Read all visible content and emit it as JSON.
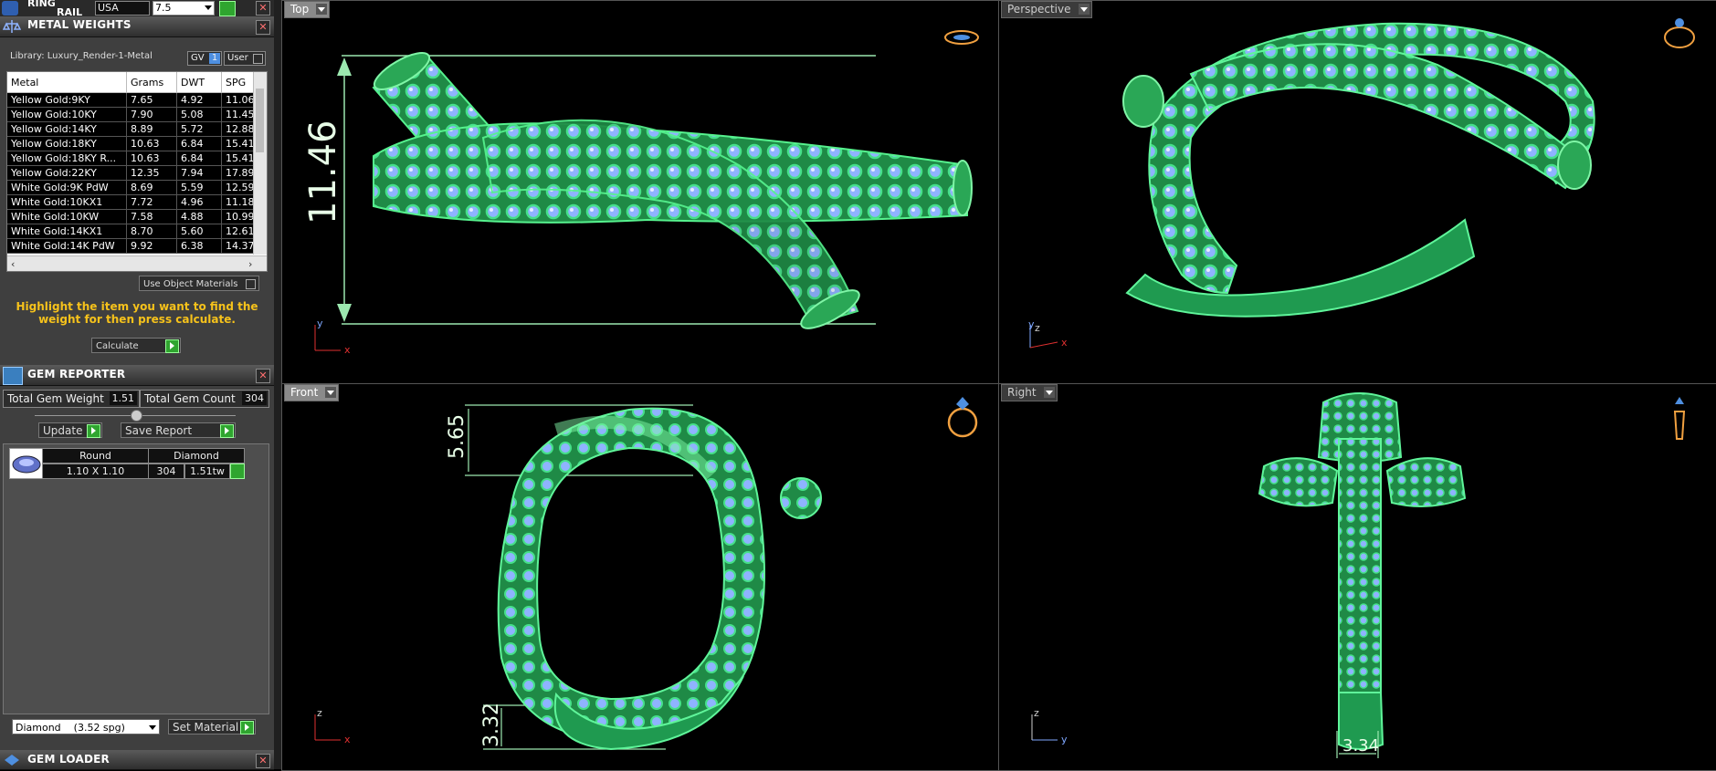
{
  "ringrail": {
    "title_line1": "RING",
    "title_line2": "RAIL",
    "country": "USA",
    "size": "7.5"
  },
  "metal_weights": {
    "title": "METAL WEIGHTS",
    "library": "Library: Luxury_Render-1-Metal",
    "gv": "GV",
    "gv_num": "1",
    "user": "User",
    "columns": [
      "Metal",
      "Grams",
      "DWT",
      "SPG"
    ],
    "rows": [
      [
        "Yellow Gold:9KY",
        "7.65",
        "4.92",
        "11.06"
      ],
      [
        "Yellow Gold:10KY",
        "7.90",
        "5.08",
        "11.45"
      ],
      [
        "Yellow Gold:14KY",
        "8.89",
        "5.72",
        "12.88"
      ],
      [
        "Yellow Gold:18KY",
        "10.63",
        "6.84",
        "15.41"
      ],
      [
        "Yellow Gold:18KY R...",
        "10.63",
        "6.84",
        "15.41"
      ],
      [
        "Yellow Gold:22KY",
        "12.35",
        "7.94",
        "17.89"
      ],
      [
        "White Gold:9K PdW",
        "8.69",
        "5.59",
        "12.59"
      ],
      [
        "White Gold:10KX1",
        "7.72",
        "4.96",
        "11.18"
      ],
      [
        "White Gold:10KW",
        "7.58",
        "4.88",
        "10.99"
      ],
      [
        "White Gold:14KX1",
        "8.70",
        "5.60",
        "12.61"
      ],
      [
        "White Gold:14K PdW",
        "9.92",
        "6.38",
        "14.37"
      ]
    ],
    "use_object_materials": "Use Object Materials",
    "hint": "Highlight the item you want to find the weight for then press calculate.",
    "calculate": "Calculate"
  },
  "gem_reporter": {
    "title": "GEM REPORTER",
    "total_weight_label": "Total Gem Weight",
    "total_weight": "1.51",
    "total_count_label": "Total Gem Count",
    "total_count": "304",
    "update": "Update",
    "save_report": "Save Report",
    "col_shape": "Round",
    "col_material": "Diamond",
    "row_size": "1.10 X 1.10",
    "row_count": "304",
    "row_tw": "1.51tw",
    "material_select": "Diamond    (3.52 spg)",
    "set_material": "Set Material"
  },
  "gem_loader": {
    "title": "GEM LOADER"
  },
  "viewports": {
    "top": {
      "label": "Top",
      "dim": "11.46",
      "ax1": "y",
      "ax2": "x"
    },
    "perspective": {
      "label": "Perspective",
      "ax1": "z",
      "ax2": "x",
      "ax3": "y"
    },
    "front": {
      "label": "Front",
      "dim1": "5.65",
      "dim2": "3.32",
      "ax1": "z",
      "ax2": "x"
    },
    "right": {
      "label": "Right",
      "dim": "3.34",
      "ax1": "z",
      "ax2": "y"
    }
  },
  "colors": {
    "accent_green": "#2fa52f",
    "hint_yellow": "#f6c21b",
    "axis_red": "#e03030",
    "ring_green": "#2db35a",
    "gem_blue": "#8fb3ff"
  }
}
